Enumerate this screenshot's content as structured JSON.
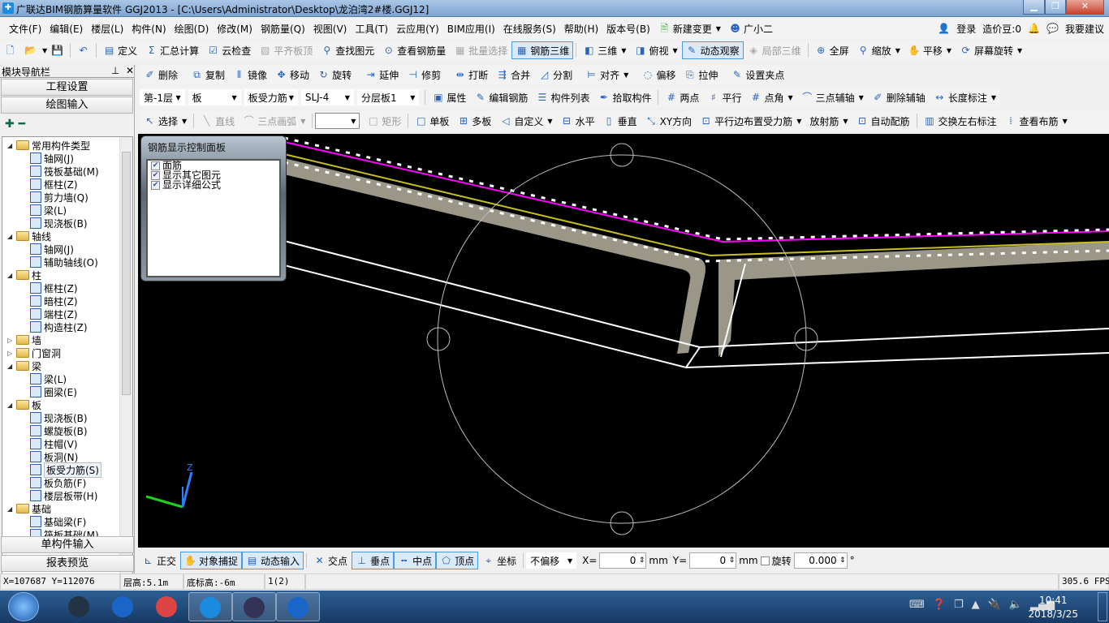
{
  "window": {
    "title": "广联达BIM钢筋算量软件 GGJ2013 - [C:\\Users\\Administrator\\Desktop\\龙泊湾2#楼.GGJ12]",
    "controls": [
      "minimize",
      "restore",
      "close"
    ]
  },
  "menu": {
    "items": [
      "文件(F)",
      "编辑(E)",
      "楼层(L)",
      "构件(N)",
      "绘图(D)",
      "修改(M)",
      "钢筋量(Q)",
      "视图(V)",
      "工具(T)",
      "云应用(Y)",
      "BIM应用(I)",
      "在线服务(S)",
      "帮助(H)",
      "版本号(B)",
      "新建变更",
      "广小二"
    ],
    "right": {
      "login": "登录",
      "beans": "造价豆:0",
      "suggest": "我要建议"
    }
  },
  "toolbar1": [
    {
      "icon": "new-file-icon",
      "label": ""
    },
    {
      "icon": "open-folder-icon",
      "label": ""
    },
    {
      "icon": "save-icon",
      "label": ""
    },
    {
      "icon": "undo-icon",
      "label": ""
    },
    {
      "icon": "define-icon",
      "label": "定义"
    },
    {
      "icon": "sigma-icon",
      "label": "汇总计算"
    },
    {
      "icon": "cloud-check-icon",
      "label": "云检查"
    },
    {
      "icon": "align-slab-icon",
      "label": "平齐板顶",
      "disabled": true
    },
    {
      "icon": "find-icon",
      "label": "查找图元"
    },
    {
      "icon": "view-rebar-icon",
      "label": "查看钢筋量"
    },
    {
      "icon": "batch-select-icon",
      "label": "批量选择",
      "disabled": true
    },
    {
      "icon": "rebar-3d-icon",
      "label": "钢筋三维",
      "active": true
    },
    {
      "icon": "cube-3d-icon",
      "label": "三维",
      "dropdown": true
    },
    {
      "icon": "top-view-icon",
      "label": "俯视",
      "dropdown": true
    },
    {
      "icon": "orbit-icon",
      "label": "动态观察",
      "active": true
    },
    {
      "icon": "partial-3d-icon",
      "label": "局部三维",
      "disabled": true
    },
    {
      "icon": "fullscreen-icon",
      "label": "全屏"
    },
    {
      "icon": "zoom-icon",
      "label": "缩放",
      "dropdown": true
    },
    {
      "icon": "pan-icon",
      "label": "平移",
      "dropdown": true
    },
    {
      "icon": "rotate-screen-icon",
      "label": "屏幕旋转",
      "dropdown": true
    }
  ],
  "nav": {
    "title": "模块导航栏",
    "top_buttons": [
      "工程设置",
      "绘图输入"
    ],
    "bottom_buttons": [
      "单构件输入",
      "报表预览"
    ],
    "tree": [
      {
        "l": 0,
        "t": "常用构件类型",
        "f": true,
        "o": true
      },
      {
        "l": 1,
        "t": "轴网(J)"
      },
      {
        "l": 1,
        "t": "筏板基础(M)"
      },
      {
        "l": 1,
        "t": "框柱(Z)"
      },
      {
        "l": 1,
        "t": "剪力墙(Q)"
      },
      {
        "l": 1,
        "t": "梁(L)"
      },
      {
        "l": 1,
        "t": "现浇板(B)"
      },
      {
        "l": 0,
        "t": "轴线",
        "f": true,
        "o": true
      },
      {
        "l": 1,
        "t": "轴网(J)"
      },
      {
        "l": 1,
        "t": "辅助轴线(O)"
      },
      {
        "l": 0,
        "t": "柱",
        "f": true,
        "o": true
      },
      {
        "l": 1,
        "t": "框柱(Z)"
      },
      {
        "l": 1,
        "t": "暗柱(Z)"
      },
      {
        "l": 1,
        "t": "端柱(Z)"
      },
      {
        "l": 1,
        "t": "构造柱(Z)"
      },
      {
        "l": 0,
        "t": "墙",
        "f": true,
        "o": false
      },
      {
        "l": 0,
        "t": "门窗洞",
        "f": true,
        "o": false
      },
      {
        "l": 0,
        "t": "梁",
        "f": true,
        "o": true
      },
      {
        "l": 1,
        "t": "梁(L)"
      },
      {
        "l": 1,
        "t": "圈梁(E)"
      },
      {
        "l": 0,
        "t": "板",
        "f": true,
        "o": true
      },
      {
        "l": 1,
        "t": "现浇板(B)"
      },
      {
        "l": 1,
        "t": "螺旋板(B)"
      },
      {
        "l": 1,
        "t": "柱帽(V)"
      },
      {
        "l": 1,
        "t": "板洞(N)"
      },
      {
        "l": 1,
        "t": "板受力筋(S)",
        "sel": true
      },
      {
        "l": 1,
        "t": "板负筋(F)"
      },
      {
        "l": 1,
        "t": "楼层板带(H)"
      },
      {
        "l": 0,
        "t": "基础",
        "f": true,
        "o": true
      },
      {
        "l": 1,
        "t": "基础梁(F)"
      },
      {
        "l": 1,
        "t": "筏板基础(M)"
      }
    ]
  },
  "toolbar2": [
    {
      "icon": "delete-icon",
      "label": "删除"
    },
    {
      "icon": "copy-icon",
      "label": "复制"
    },
    {
      "icon": "mirror-icon",
      "label": "镜像"
    },
    {
      "icon": "move-icon",
      "label": "移动"
    },
    {
      "icon": "rotate-icon",
      "label": "旋转"
    },
    {
      "icon": "extend-icon",
      "label": "延伸"
    },
    {
      "icon": "trim-icon",
      "label": "修剪"
    },
    {
      "icon": "break-icon",
      "label": "打断"
    },
    {
      "icon": "merge-icon",
      "label": "合并"
    },
    {
      "icon": "split-icon",
      "label": "分割"
    },
    {
      "icon": "align-icon",
      "label": "对齐",
      "dropdown": true
    },
    {
      "icon": "offset-icon",
      "label": "偏移"
    },
    {
      "icon": "stretch-icon",
      "label": "拉伸"
    },
    {
      "icon": "grip-icon",
      "label": "设置夹点"
    }
  ],
  "toolbar3": {
    "selects": [
      "第-1层",
      "板",
      "板受力筋",
      "SLJ-4",
      "分层板1"
    ],
    "buttons": [
      {
        "icon": "properties-icon",
        "label": "属性"
      },
      {
        "icon": "edit-rebar-icon",
        "label": "编辑钢筋"
      },
      {
        "icon": "component-list-icon",
        "label": "构件列表"
      },
      {
        "icon": "pick-icon",
        "label": "拾取构件"
      },
      {
        "icon": "two-point-icon",
        "label": "两点"
      },
      {
        "icon": "parallel-icon",
        "label": "平行"
      },
      {
        "icon": "point-angle-icon",
        "label": "点角",
        "dropdown": true
      },
      {
        "icon": "three-point-axis-icon",
        "label": "三点辅轴",
        "dropdown": true
      },
      {
        "icon": "delete-axis-icon",
        "label": "删除辅轴"
      },
      {
        "icon": "dimension-icon",
        "label": "长度标注",
        "dropdown": true
      }
    ]
  },
  "toolbar4": [
    {
      "icon": "select-icon",
      "label": "选择",
      "dropdown": true
    },
    {
      "icon": "line-icon",
      "label": "直线",
      "disabled": true
    },
    {
      "icon": "arc-icon",
      "label": "三点画弧",
      "disabled": true,
      "dropdown": true
    },
    {
      "icon": "combo",
      "label": ""
    },
    {
      "icon": "rectangle-icon",
      "label": "矩形",
      "disabled": true
    },
    {
      "icon": "single-slab-icon",
      "label": "单板"
    },
    {
      "icon": "multi-slab-icon",
      "label": "多板"
    },
    {
      "icon": "custom-icon",
      "label": "自定义",
      "dropdown": true
    },
    {
      "icon": "horizontal-icon",
      "label": "水平"
    },
    {
      "icon": "vertical-icon",
      "label": "垂直"
    },
    {
      "icon": "xy-direction-icon",
      "label": "XY方向"
    },
    {
      "icon": "parallel-edge-icon",
      "label": "平行边布置受力筋",
      "dropdown": true
    },
    {
      "icon": "",
      "label": "放射筋",
      "dropdown": true
    },
    {
      "icon": "auto-rebar-icon",
      "label": "自动配筋"
    },
    {
      "icon": "swap-label-icon",
      "label": "交换左右标注"
    },
    {
      "icon": "view-layout-icon",
      "label": "查看布筋",
      "dropdown": true
    }
  ],
  "rebar_panel": {
    "title": "钢筋显示控制面板",
    "options": [
      {
        "label": "面筋",
        "checked": true
      },
      {
        "label": "显示其它图元",
        "checked": true
      },
      {
        "label": "显示详细公式",
        "checked": true
      }
    ]
  },
  "axis": {
    "z": "Z"
  },
  "bottom": {
    "snap": [
      {
        "icon": "ortho-icon",
        "label": "正交"
      },
      {
        "icon": "object-snap-icon",
        "label": "对象捕捉",
        "active": true
      },
      {
        "icon": "dynamic-input-icon",
        "label": "动态输入",
        "active": true
      },
      {
        "icon": "intersection-icon",
        "label": "交点"
      },
      {
        "icon": "perpendicular-icon",
        "label": "垂点",
        "active": true
      },
      {
        "icon": "midpoint-icon",
        "label": "中点",
        "active": true
      },
      {
        "icon": "vertex-icon",
        "label": "顶点",
        "active": true
      },
      {
        "icon": "coordinate-icon",
        "label": "坐标"
      }
    ],
    "offset": "不偏移",
    "x_label": "X=",
    "x": "0",
    "y_label": "Y=",
    "y": "0",
    "unit": "mm",
    "rotate_label": "旋转",
    "rotate": "0.000",
    "deg": "°",
    "rotate_checked": false
  },
  "status": {
    "coords": "X=107687 Y=112076",
    "floor_height": "层高:5.1m",
    "bottom_elev": "底标高:-6m",
    "count": "1(2)",
    "fps": "305.6 FPS"
  },
  "taskbar": {
    "time": "10:41",
    "date": "2018/3/25",
    "apps": [
      "pen-app-icon",
      "ie-icon",
      "chrome-icon",
      "glodon-icon",
      "cad-icon",
      "ie-icon"
    ]
  },
  "colors": {
    "canvas": "#000000",
    "accent": "#4a9be0",
    "rebar_top": "#ff00ff",
    "rebar_mid": "#c8c020",
    "slab": "#9a9688"
  }
}
